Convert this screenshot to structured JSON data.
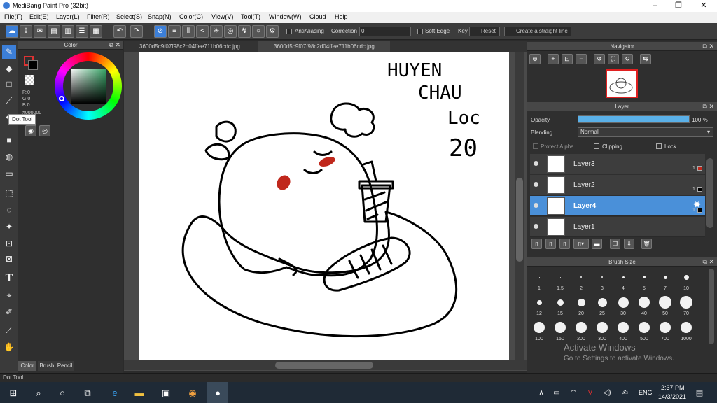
{
  "window": {
    "title": "MediBang Paint Pro (32bit)",
    "min": "–",
    "max": "❐",
    "close": "✕"
  },
  "menu": [
    "File(F)",
    "Edit(E)",
    "Layer(L)",
    "Filter(R)",
    "Select(S)",
    "Snap(N)",
    "Color(C)",
    "View(V)",
    "Tool(T)",
    "Window(W)",
    "Cloud",
    "Help"
  ],
  "toolbar": {
    "antialiasing": "AntiAliasing",
    "correction_label": "Correction",
    "correction_value": "0",
    "soft_edge": "Soft Edge",
    "key": "Key",
    "reset": "Reset",
    "straight_line": "Create a straight line"
  },
  "color_panel": {
    "title": "Color",
    "r": "R:0",
    "g": "G:0",
    "b": "B:0",
    "hex": "#000000",
    "fg": "#000000",
    "bg": "#ffffff"
  },
  "tooltip": "Dot Tool",
  "tabs": [
    "3600d5c9f07f98c2d04ffee711b06cdc.jpg",
    "3600d5c9f07f98c2d04ffee711b06cdc.jpg"
  ],
  "canvas_text": {
    "line1": "HUYEN",
    "line2": "CHAU",
    "line3": "Loc",
    "line4": "20"
  },
  "navigator": {
    "title": "Navigator"
  },
  "layer_panel": {
    "title": "Layer",
    "opacity_label": "Opacity",
    "opacity_value": "100 %",
    "opacity_fraction": 1.0,
    "blending_label": "Blending",
    "blending_value": "Normal",
    "protect_alpha": "Protect Alpha",
    "clipping": "Clipping",
    "lock": "Lock",
    "layers": [
      {
        "name": "Layer3",
        "num": "1",
        "swatch": "#c0281c",
        "selected": false
      },
      {
        "name": "Layer2",
        "num": "1",
        "swatch": "#000000",
        "selected": false
      },
      {
        "name": "Layer4",
        "num": "1",
        "swatch": "#000000",
        "selected": true
      },
      {
        "name": "Layer1",
        "num": "",
        "swatch": "",
        "selected": false
      }
    ]
  },
  "brush_size": {
    "title": "Brush Size",
    "sizes": [
      "1",
      "1.5",
      "2",
      "3",
      "4",
      "5",
      "7",
      "10",
      "12",
      "15",
      "20",
      "25",
      "30",
      "40",
      "50",
      "70",
      "100",
      "150",
      "200",
      "300",
      "400",
      "500",
      "700",
      "1000"
    ]
  },
  "bottom_tabs": {
    "color": "Color",
    "brush": "Brush: Pencil"
  },
  "status": "Dot Tool",
  "watermark": {
    "line1": "Activate Windows",
    "line2": "Go to Settings to activate Windows."
  },
  "taskbar": {
    "lang": "ENG",
    "time": "2:37 PM",
    "date": "14/3/2021"
  },
  "accent": "#3c7fd8"
}
